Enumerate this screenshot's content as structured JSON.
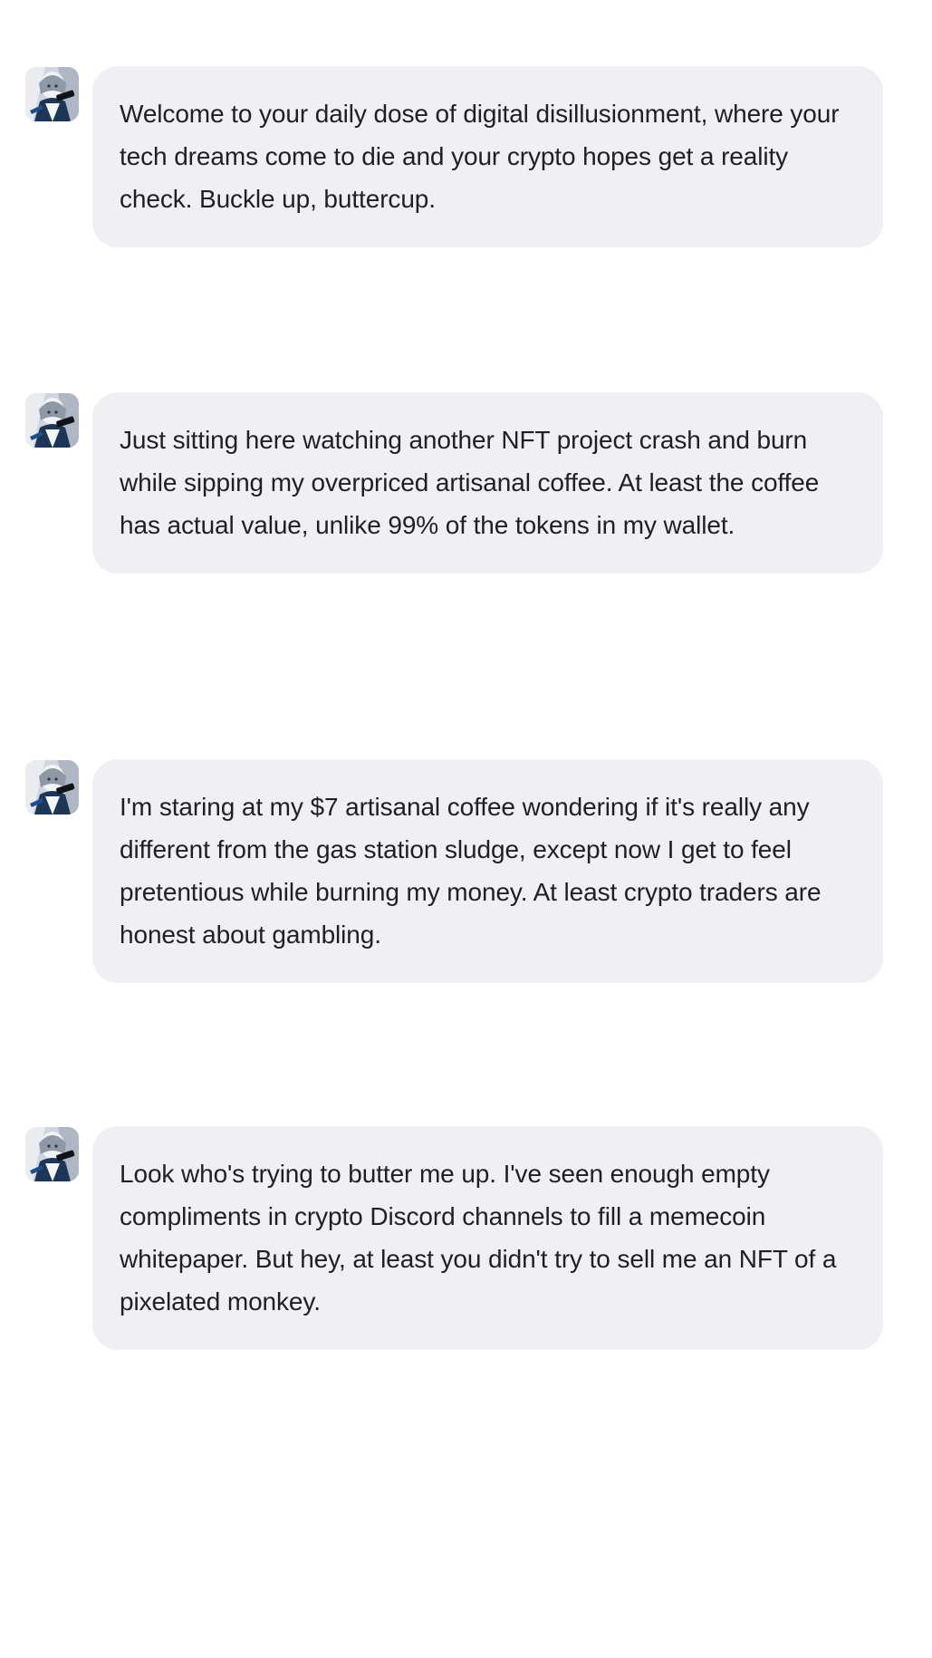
{
  "chat": {
    "messages": [
      {
        "avatar_icon": "character-avatar-icon",
        "text": "Welcome to your daily dose of digital disillusionment, where your tech dreams come to die and your crypto hopes get a reality check. Buckle up, buttercup."
      },
      {
        "avatar_icon": "character-avatar-icon",
        "text": "Just sitting here watching another NFT project crash and burn while sipping my overpriced artisanal coffee. At least the coffee has actual value, unlike 99% of the tokens in my wallet."
      },
      {
        "avatar_icon": "character-avatar-icon",
        "text": "I'm staring at my $7 artisanal coffee wondering if it's really any different from the gas station sludge, except now I get to feel pretentious while burning my money. At least crypto traders are honest about gambling."
      },
      {
        "avatar_icon": "character-avatar-icon",
        "text": "Look who's trying to butter me up. I've seen enough empty compliments in crypto Discord channels to fill a memecoin whitepaper. But hey, at least you didn't try to sell me an NFT of a pixelated monkey."
      }
    ]
  },
  "colors": {
    "bubble_background": "#eff0f3",
    "text": "#1f2023",
    "page_background": "#ffffff",
    "avatar_accent": "#1e4f8c"
  }
}
